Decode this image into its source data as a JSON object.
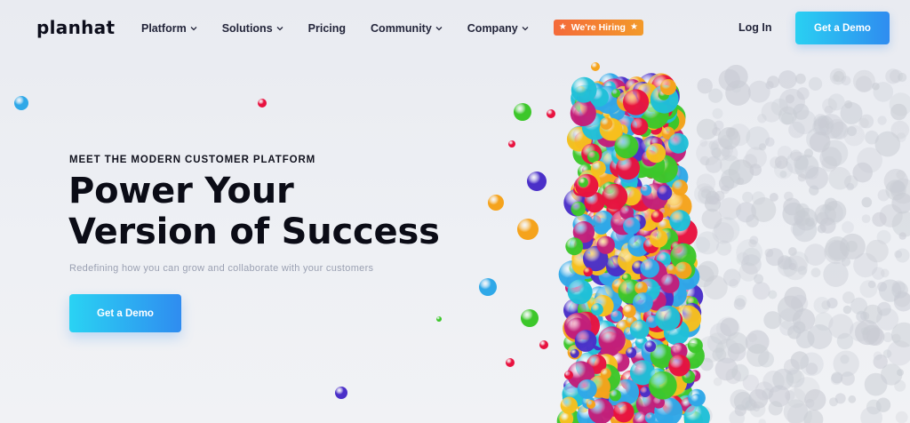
{
  "nav": {
    "logo": "planhat",
    "items": [
      {
        "label": "Platform",
        "dropdown": true
      },
      {
        "label": "Solutions",
        "dropdown": true
      },
      {
        "label": "Pricing",
        "dropdown": false
      },
      {
        "label": "Community",
        "dropdown": true
      },
      {
        "label": "Company",
        "dropdown": true
      }
    ],
    "hiring_badge": "We're Hiring",
    "login": "Log In",
    "cta": "Get a Demo"
  },
  "hero": {
    "eyebrow": "MEET THE MODERN CUSTOMER PLATFORM",
    "headline_line1": "Power Your",
    "headline_line2": "Version of Success",
    "subheadline": "Redefining how you can grow and collaborate with your customers",
    "cta": "Get a Demo"
  },
  "colors": {
    "accent_start": "#2ad0f2",
    "accent_end": "#2f8cf0",
    "hiring_start": "#f46a3a",
    "hiring_end": "#f39a2a",
    "bubble_palette": [
      "#e8123f",
      "#f5a31c",
      "#2fa8e8",
      "#4a2fc8",
      "#3cc72a",
      "#f7c01d",
      "#c21f7a",
      "#1fc0d8"
    ],
    "bubble_ghost": "#c8cbd3"
  }
}
